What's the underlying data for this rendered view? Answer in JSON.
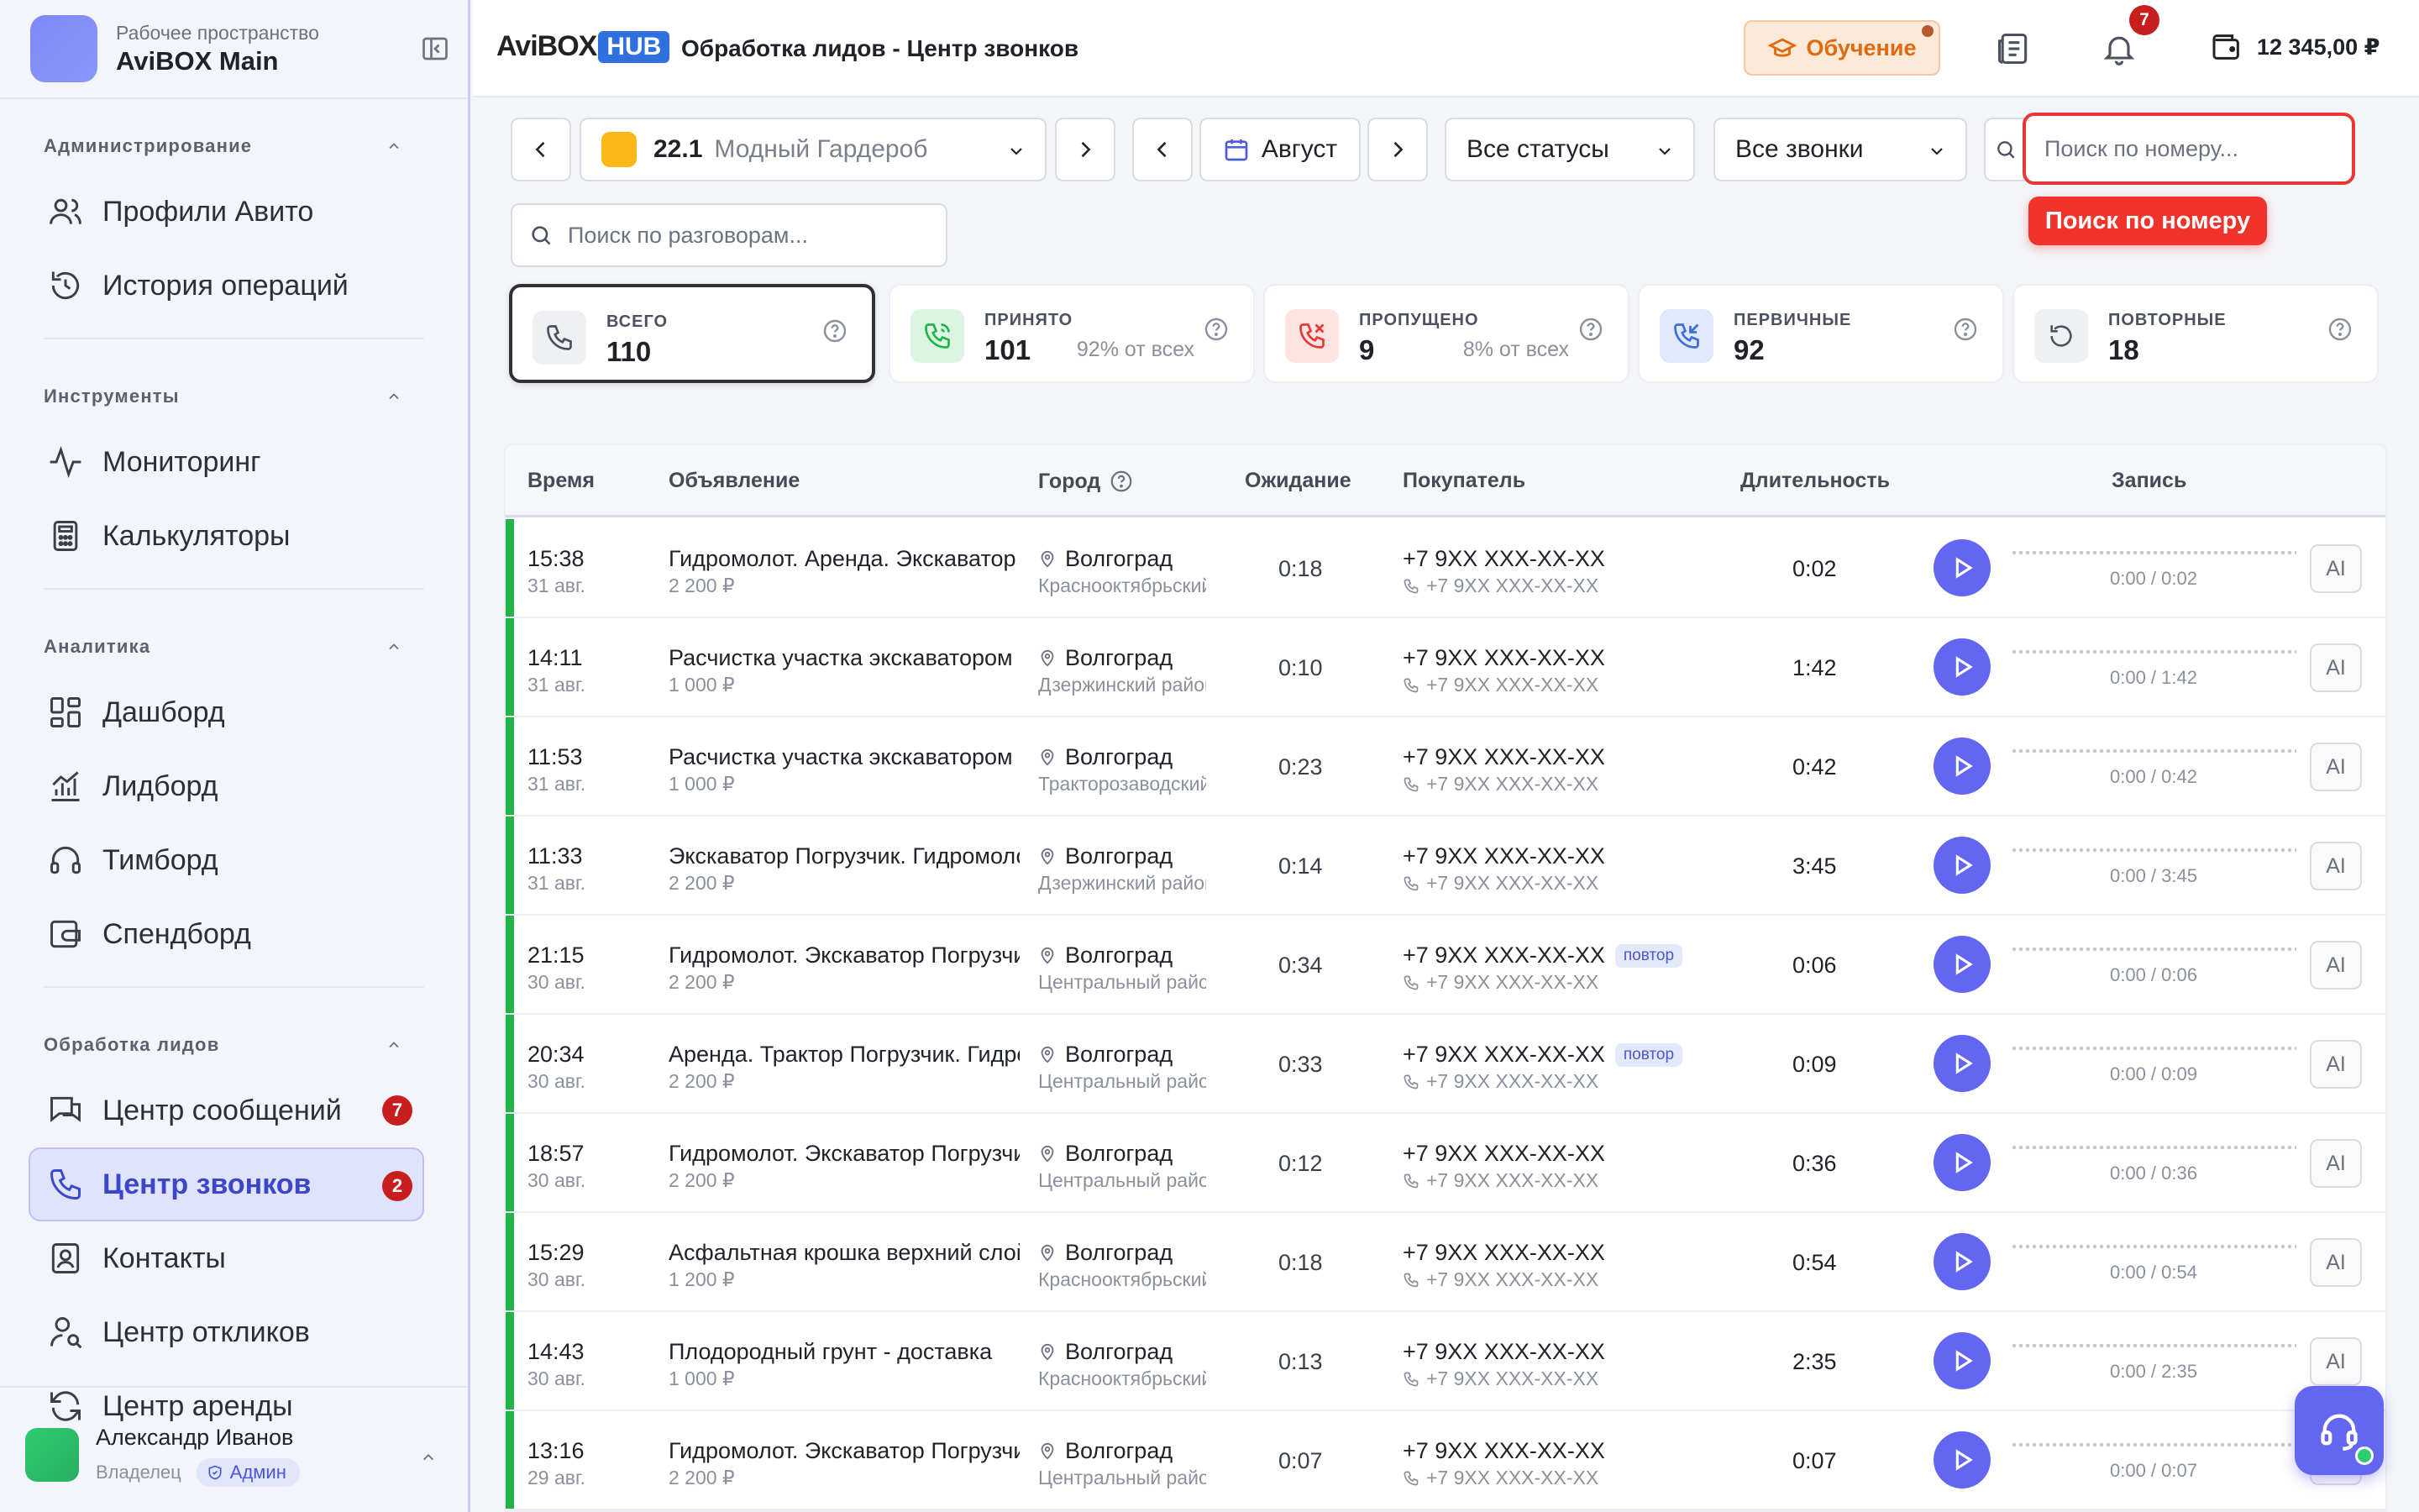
{
  "workspace": {
    "label": "Рабочее пространство",
    "name": "AviBOX Main"
  },
  "nav": {
    "sections": [
      {
        "title": "Администрирование",
        "items": [
          {
            "label": "Профили Авито",
            "icon": "users-icon"
          },
          {
            "label": "История операций",
            "icon": "history-icon"
          }
        ]
      },
      {
        "title": "Инструменты",
        "items": [
          {
            "label": "Мониторинг",
            "icon": "activity-icon"
          },
          {
            "label": "Калькуляторы",
            "icon": "calculator-icon"
          }
        ]
      },
      {
        "title": "Аналитика",
        "items": [
          {
            "label": "Дашборд",
            "icon": "dashboard-icon"
          },
          {
            "label": "Лидборд",
            "icon": "chart-icon"
          },
          {
            "label": "Тимборд",
            "icon": "headphones-icon"
          },
          {
            "label": "Спендборд",
            "icon": "wallet-icon"
          }
        ]
      },
      {
        "title": "Обработка лидов",
        "items": [
          {
            "label": "Центр сообщений",
            "icon": "chat-icon",
            "badge": "7"
          },
          {
            "label": "Центр звонков",
            "icon": "phone-icon",
            "badge": "2",
            "active": true
          },
          {
            "label": "Контакты",
            "icon": "contacts-icon"
          },
          {
            "label": "Центр откликов",
            "icon": "user-search-icon"
          },
          {
            "label": "Центр аренды",
            "icon": "refresh-icon"
          }
        ]
      }
    ]
  },
  "user": {
    "name": "Александр Иванов",
    "role": "Владелец",
    "chip": "Админ"
  },
  "header": {
    "logo_avi": "AviBOX",
    "logo_hub": "HUB",
    "title": "Обработка лидов - Центр звонков",
    "learn_label": "Обучение",
    "notif_count": "7",
    "balance": "12 345,00 ₽"
  },
  "toolbar": {
    "ad_num": "22.1",
    "ad_name": "Модный Гардероб",
    "month": "Август",
    "status": "Все статусы",
    "calls": "Все звонки",
    "search_number_placeholder": "Поиск по номеру...",
    "tooltip": "Поиск по номеру",
    "search_conv_placeholder": "Поиск по разговорам..."
  },
  "stats": [
    {
      "label": "ВСЕГО",
      "value": "110",
      "pct": ""
    },
    {
      "label": "ПРИНЯТО",
      "value": "101",
      "pct": "92% от всех"
    },
    {
      "label": "ПРОПУЩЕНО",
      "value": "9",
      "pct": "8% от всех"
    },
    {
      "label": "ПЕРВИЧНЫЕ",
      "value": "92",
      "pct": ""
    },
    {
      "label": "ПОВТОРНЫЕ",
      "value": "18",
      "pct": ""
    }
  ],
  "table": {
    "columns": [
      "Время",
      "Объявление",
      "Город",
      "Ожидание",
      "Покупатель",
      "Длительность",
      "Запись"
    ],
    "rows": [
      {
        "time": "15:38",
        "date": "31 авг.",
        "ad": "Гидромолот. Аренда. Экскаватор",
        "price": "2 200 ₽",
        "city": "Волгоград",
        "district": "Краснооктябрьский",
        "wait": "0:18",
        "phone": "+7 9XX XXX-XX-XX",
        "phone2": "+7 9XX XXX-XX-XX",
        "repeat": "",
        "duration": "0:02",
        "rec": "0:00 / 0:02"
      },
      {
        "time": "14:11",
        "date": "31 авг.",
        "ad": "Расчистка участка экскаватором",
        "price": "1 000 ₽",
        "city": "Волгоград",
        "district": "Дзержинский район",
        "wait": "0:10",
        "phone": "+7 9XX XXX-XX-XX",
        "phone2": "+7 9XX XXX-XX-XX",
        "repeat": "",
        "duration": "1:42",
        "rec": "0:00 / 1:42"
      },
      {
        "time": "11:53",
        "date": "31 авг.",
        "ad": "Расчистка участка экскаватором",
        "price": "1 000 ₽",
        "city": "Волгоград",
        "district": "Тракторозаводский",
        "wait": "0:23",
        "phone": "+7 9XX XXX-XX-XX",
        "phone2": "+7 9XX XXX-XX-XX",
        "repeat": "",
        "duration": "0:42",
        "rec": "0:00 / 0:42"
      },
      {
        "time": "11:33",
        "date": "31 авг.",
        "ad": "Экскаватор Погрузчик. Гидромолот",
        "price": "2 200 ₽",
        "city": "Волгоград",
        "district": "Дзержинский район",
        "wait": "0:14",
        "phone": "+7 9XX XXX-XX-XX",
        "phone2": "+7 9XX XXX-XX-XX",
        "repeat": "",
        "duration": "3:45",
        "rec": "0:00 / 3:45"
      },
      {
        "time": "21:15",
        "date": "30 авг.",
        "ad": "Гидромолот. Экскаватор Погрузчик",
        "price": "2 200 ₽",
        "city": "Волгоград",
        "district": "Центральный район",
        "wait": "0:34",
        "phone": "+7 9XX XXX-XX-XX",
        "phone2": "+7 9XX XXX-XX-XX",
        "repeat": "повтор",
        "duration": "0:06",
        "rec": "0:00 / 0:06"
      },
      {
        "time": "20:34",
        "date": "30 авг.",
        "ad": "Аренда. Трактор Погрузчик. Гидромолот",
        "price": "2 200 ₽",
        "city": "Волгоград",
        "district": "Центральный район",
        "wait": "0:33",
        "phone": "+7 9XX XXX-XX-XX",
        "phone2": "+7 9XX XXX-XX-XX",
        "repeat": "повтор",
        "duration": "0:09",
        "rec": "0:00 / 0:09"
      },
      {
        "time": "18:57",
        "date": "30 авг.",
        "ad": "Гидромолот. Экскаватор Погрузчик",
        "price": "2 200 ₽",
        "city": "Волгоград",
        "district": "Центральный район",
        "wait": "0:12",
        "phone": "+7 9XX XXX-XX-XX",
        "phone2": "+7 9XX XXX-XX-XX",
        "repeat": "",
        "duration": "0:36",
        "rec": "0:00 / 0:36"
      },
      {
        "time": "15:29",
        "date": "30 авг.",
        "ad": "Асфальтная крошка верхний слой",
        "price": "1 200 ₽",
        "city": "Волгоград",
        "district": "Краснооктябрьский",
        "wait": "0:18",
        "phone": "+7 9XX XXX-XX-XX",
        "phone2": "+7 9XX XXX-XX-XX",
        "repeat": "",
        "duration": "0:54",
        "rec": "0:00 / 0:54"
      },
      {
        "time": "14:43",
        "date": "30 авг.",
        "ad": "Плодородный грунт - доставка",
        "price": "1 000 ₽",
        "city": "Волгоград",
        "district": "Краснооктябрьский",
        "wait": "0:13",
        "phone": "+7 9XX XXX-XX-XX",
        "phone2": "+7 9XX XXX-XX-XX",
        "repeat": "",
        "duration": "2:35",
        "rec": "0:00 / 2:35"
      },
      {
        "time": "13:16",
        "date": "29 авг.",
        "ad": "Гидромолот. Экскаватор Погрузчик",
        "price": "2 200 ₽",
        "city": "Волгоград",
        "district": "Центральный район",
        "wait": "0:07",
        "phone": "+7 9XX XXX-XX-XX",
        "phone2": "+7 9XX XXX-XX-XX",
        "repeat": "",
        "duration": "0:07",
        "rec": "0:00 / 0:07"
      }
    ],
    "ai_label": "AI"
  },
  "colors": {
    "accent": "#6366f1",
    "green": "#22b34a",
    "red": "#e53935",
    "orange": "#e06a12"
  }
}
